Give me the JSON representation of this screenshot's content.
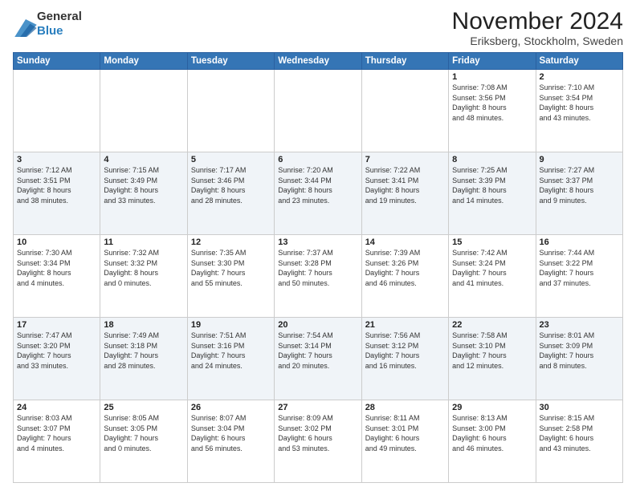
{
  "logo": {
    "general": "General",
    "blue": "Blue"
  },
  "title": "November 2024",
  "location": "Eriksberg, Stockholm, Sweden",
  "days_of_week": [
    "Sunday",
    "Monday",
    "Tuesday",
    "Wednesday",
    "Thursday",
    "Friday",
    "Saturday"
  ],
  "weeks": [
    {
      "days": [
        {
          "number": "",
          "info": ""
        },
        {
          "number": "",
          "info": ""
        },
        {
          "number": "",
          "info": ""
        },
        {
          "number": "",
          "info": ""
        },
        {
          "number": "",
          "info": ""
        },
        {
          "number": "1",
          "info": "Sunrise: 7:08 AM\nSunset: 3:56 PM\nDaylight: 8 hours\nand 48 minutes."
        },
        {
          "number": "2",
          "info": "Sunrise: 7:10 AM\nSunset: 3:54 PM\nDaylight: 8 hours\nand 43 minutes."
        }
      ]
    },
    {
      "days": [
        {
          "number": "3",
          "info": "Sunrise: 7:12 AM\nSunset: 3:51 PM\nDaylight: 8 hours\nand 38 minutes."
        },
        {
          "number": "4",
          "info": "Sunrise: 7:15 AM\nSunset: 3:49 PM\nDaylight: 8 hours\nand 33 minutes."
        },
        {
          "number": "5",
          "info": "Sunrise: 7:17 AM\nSunset: 3:46 PM\nDaylight: 8 hours\nand 28 minutes."
        },
        {
          "number": "6",
          "info": "Sunrise: 7:20 AM\nSunset: 3:44 PM\nDaylight: 8 hours\nand 23 minutes."
        },
        {
          "number": "7",
          "info": "Sunrise: 7:22 AM\nSunset: 3:41 PM\nDaylight: 8 hours\nand 19 minutes."
        },
        {
          "number": "8",
          "info": "Sunrise: 7:25 AM\nSunset: 3:39 PM\nDaylight: 8 hours\nand 14 minutes."
        },
        {
          "number": "9",
          "info": "Sunrise: 7:27 AM\nSunset: 3:37 PM\nDaylight: 8 hours\nand 9 minutes."
        }
      ]
    },
    {
      "days": [
        {
          "number": "10",
          "info": "Sunrise: 7:30 AM\nSunset: 3:34 PM\nDaylight: 8 hours\nand 4 minutes."
        },
        {
          "number": "11",
          "info": "Sunrise: 7:32 AM\nSunset: 3:32 PM\nDaylight: 8 hours\nand 0 minutes."
        },
        {
          "number": "12",
          "info": "Sunrise: 7:35 AM\nSunset: 3:30 PM\nDaylight: 7 hours\nand 55 minutes."
        },
        {
          "number": "13",
          "info": "Sunrise: 7:37 AM\nSunset: 3:28 PM\nDaylight: 7 hours\nand 50 minutes."
        },
        {
          "number": "14",
          "info": "Sunrise: 7:39 AM\nSunset: 3:26 PM\nDaylight: 7 hours\nand 46 minutes."
        },
        {
          "number": "15",
          "info": "Sunrise: 7:42 AM\nSunset: 3:24 PM\nDaylight: 7 hours\nand 41 minutes."
        },
        {
          "number": "16",
          "info": "Sunrise: 7:44 AM\nSunset: 3:22 PM\nDaylight: 7 hours\nand 37 minutes."
        }
      ]
    },
    {
      "days": [
        {
          "number": "17",
          "info": "Sunrise: 7:47 AM\nSunset: 3:20 PM\nDaylight: 7 hours\nand 33 minutes."
        },
        {
          "number": "18",
          "info": "Sunrise: 7:49 AM\nSunset: 3:18 PM\nDaylight: 7 hours\nand 28 minutes."
        },
        {
          "number": "19",
          "info": "Sunrise: 7:51 AM\nSunset: 3:16 PM\nDaylight: 7 hours\nand 24 minutes."
        },
        {
          "number": "20",
          "info": "Sunrise: 7:54 AM\nSunset: 3:14 PM\nDaylight: 7 hours\nand 20 minutes."
        },
        {
          "number": "21",
          "info": "Sunrise: 7:56 AM\nSunset: 3:12 PM\nDaylight: 7 hours\nand 16 minutes."
        },
        {
          "number": "22",
          "info": "Sunrise: 7:58 AM\nSunset: 3:10 PM\nDaylight: 7 hours\nand 12 minutes."
        },
        {
          "number": "23",
          "info": "Sunrise: 8:01 AM\nSunset: 3:09 PM\nDaylight: 7 hours\nand 8 minutes."
        }
      ]
    },
    {
      "days": [
        {
          "number": "24",
          "info": "Sunrise: 8:03 AM\nSunset: 3:07 PM\nDaylight: 7 hours\nand 4 minutes."
        },
        {
          "number": "25",
          "info": "Sunrise: 8:05 AM\nSunset: 3:05 PM\nDaylight: 7 hours\nand 0 minutes."
        },
        {
          "number": "26",
          "info": "Sunrise: 8:07 AM\nSunset: 3:04 PM\nDaylight: 6 hours\nand 56 minutes."
        },
        {
          "number": "27",
          "info": "Sunrise: 8:09 AM\nSunset: 3:02 PM\nDaylight: 6 hours\nand 53 minutes."
        },
        {
          "number": "28",
          "info": "Sunrise: 8:11 AM\nSunset: 3:01 PM\nDaylight: 6 hours\nand 49 minutes."
        },
        {
          "number": "29",
          "info": "Sunrise: 8:13 AM\nSunset: 3:00 PM\nDaylight: 6 hours\nand 46 minutes."
        },
        {
          "number": "30",
          "info": "Sunrise: 8:15 AM\nSunset: 2:58 PM\nDaylight: 6 hours\nand 43 minutes."
        }
      ]
    }
  ]
}
